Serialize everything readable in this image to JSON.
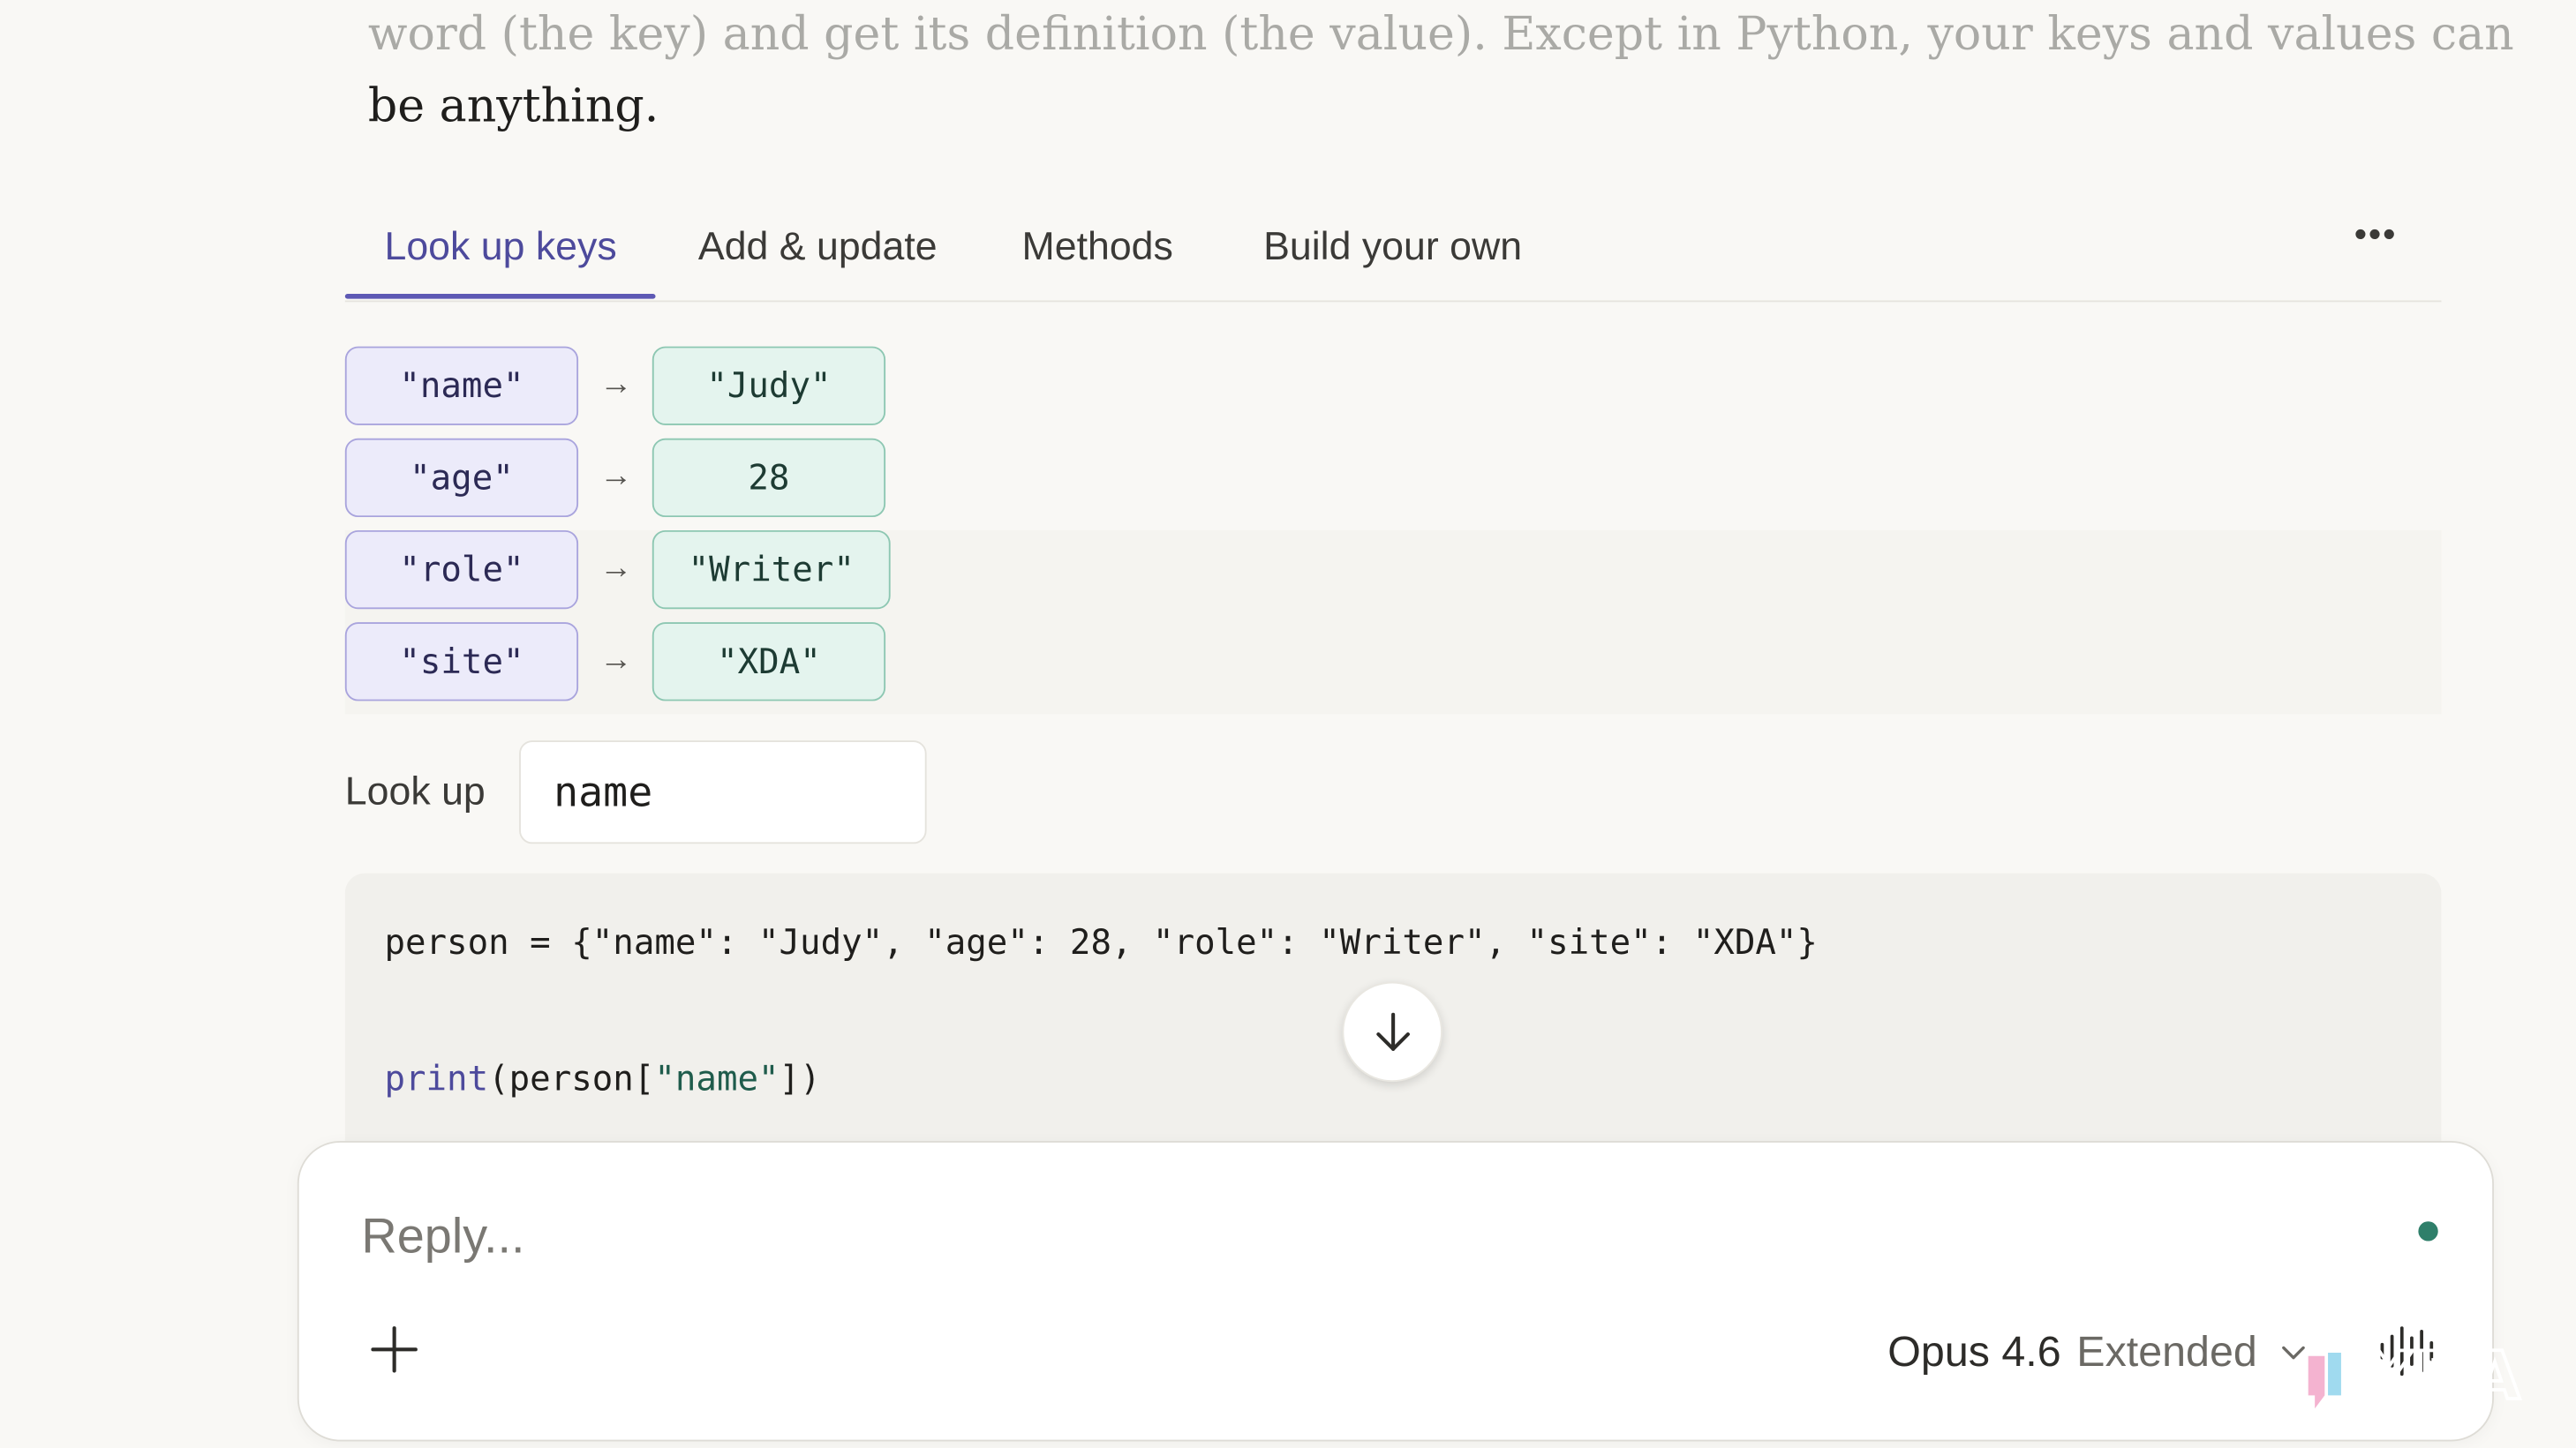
{
  "prose": {
    "line1": "word (the key) and get its definition (the value). Except in Python, your keys and values can",
    "line2": "be anything."
  },
  "tabs": [
    {
      "label": "Look up keys",
      "active": true
    },
    {
      "label": "Add & update",
      "active": false
    },
    {
      "label": "Methods",
      "active": false
    },
    {
      "label": "Build your own",
      "active": false
    }
  ],
  "more_label": "•••",
  "dict": [
    {
      "key": "\"name\"",
      "value": "\"Judy\""
    },
    {
      "key": "\"age\"",
      "value": "28"
    },
    {
      "key": "\"role\"",
      "value": "\"Writer\""
    },
    {
      "key": "\"site\"",
      "value": "\"XDA\""
    }
  ],
  "arrow_glyph": "→",
  "lookup": {
    "label": "Look up",
    "value": "name"
  },
  "code": {
    "line1": "person = {\"name\": \"Judy\", \"age\": 28, \"role\": \"Writer\", \"site\": \"XDA\"}",
    "line2_fn": "print",
    "line2_open": "(person[",
    "line2_str": "\"name\"",
    "line2_close": "])"
  },
  "reply": {
    "placeholder": "Reply...",
    "model_name": "Opus 4.6",
    "model_mode": "Extended"
  },
  "watermark_text": "XDA",
  "colors": {
    "accent": "#5e59b4",
    "key_fill": "#ecebfa",
    "value_fill": "#e4f4ee",
    "status_dot": "#2f7f6a"
  }
}
